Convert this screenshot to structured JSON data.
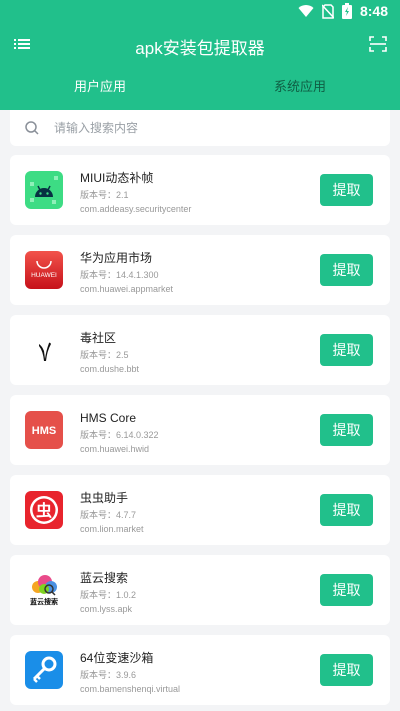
{
  "status": {
    "time": "8:48"
  },
  "header": {
    "title": "apk安装包提取器"
  },
  "tabs": [
    {
      "label": "用户应用",
      "active": true
    },
    {
      "label": "系统应用",
      "active": false
    }
  ],
  "search": {
    "placeholder": "请输入搜索内容",
    "value": ""
  },
  "colors": {
    "primary": "#21c08b",
    "background": "#f3f4f6"
  },
  "apps": [
    {
      "name": "MIUI动态补帧",
      "version": "版本号：2.1",
      "package": "com.addeasy.securitycenter",
      "icon": "android-icon",
      "button": "提取"
    },
    {
      "name": "华为应用市场",
      "version": "版本号：14.4.1.300",
      "package": "com.huawei.appmarket",
      "icon": "huawei-icon",
      "icon_text": "HUAWEI",
      "button": "提取"
    },
    {
      "name": "毒社区",
      "version": "版本号：2.5",
      "package": "com.dushe.bbt",
      "icon": "dushe-icon",
      "button": "提取"
    },
    {
      "name": "HMS Core",
      "version": "版本号：6.14.0.322",
      "package": "com.huawei.hwid",
      "icon": "hms-icon",
      "icon_text": "HMS",
      "button": "提取"
    },
    {
      "name": "虫虫助手",
      "version": "版本号：4.7.7",
      "package": "com.lion.market",
      "icon": "chongchong-icon",
      "icon_text": "虫",
      "button": "提取"
    },
    {
      "name": "蓝云搜索",
      "version": "版本号：1.0.2",
      "package": "com.lyss.apk",
      "icon": "lanyun-icon",
      "icon_text": "蓝云搜索",
      "button": "提取"
    },
    {
      "name": "64位变速沙箱",
      "version": "版本号：3.9.6",
      "package": "com.bamenshenqi.virtual",
      "icon": "sandbox-icon",
      "button": "提取"
    }
  ]
}
